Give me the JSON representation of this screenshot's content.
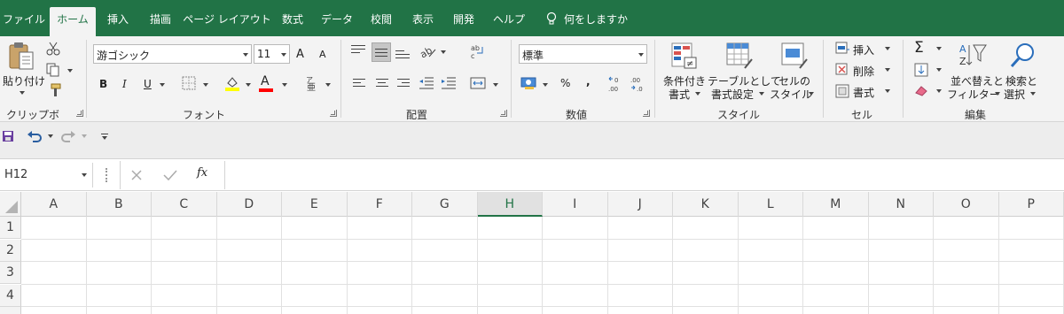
{
  "tabs": [
    {
      "label": "ファイル"
    },
    {
      "label": "ホーム"
    },
    {
      "label": "挿入"
    },
    {
      "label": "描画"
    },
    {
      "label": "ページ レイアウト"
    },
    {
      "label": "数式"
    },
    {
      "label": "データ"
    },
    {
      "label": "校閲"
    },
    {
      "label": "表示"
    },
    {
      "label": "開発"
    },
    {
      "label": "ヘルプ"
    }
  ],
  "tell_me": "何をしますか",
  "clipboard": {
    "paste": "貼り付け",
    "label": "クリップボード"
  },
  "font": {
    "name": "游ゴシック",
    "size": "11",
    "label": "フォント",
    "bold": "B",
    "italic": "I",
    "underline": "U",
    "increase": "A",
    "decrease": "A"
  },
  "alignment": {
    "label": "配置"
  },
  "number": {
    "format": "標準",
    "label": "数値",
    "percent": "%",
    "comma": ","
  },
  "styles": {
    "conditional_1": "条件付き",
    "conditional_2": "書式",
    "table_1": "テーブルとして",
    "table_2": "書式設定",
    "cell_1": "セルの",
    "cell_2": "スタイル",
    "label": "スタイル"
  },
  "cells": {
    "insert": "挿入",
    "delete": "削除",
    "format": "書式",
    "label": "セル"
  },
  "editing": {
    "sort_1": "並べ替えと",
    "sort_2": "フィルター",
    "find_1": "検索と",
    "find_2": "選択",
    "label": "編集",
    "sigma": "Σ"
  },
  "formula_bar": {
    "name_box": "H12",
    "fx": "fx",
    "value": ""
  },
  "columns": [
    "A",
    "B",
    "C",
    "D",
    "E",
    "F",
    "G",
    "H",
    "I",
    "J",
    "K",
    "L",
    "M",
    "N",
    "O",
    "P"
  ],
  "rows": [
    "1",
    "2",
    "3",
    "4"
  ],
  "selected_column": "H",
  "colors": {
    "accent": "#217346",
    "font_color": "#ff0000",
    "highlight": "#ffff00"
  }
}
